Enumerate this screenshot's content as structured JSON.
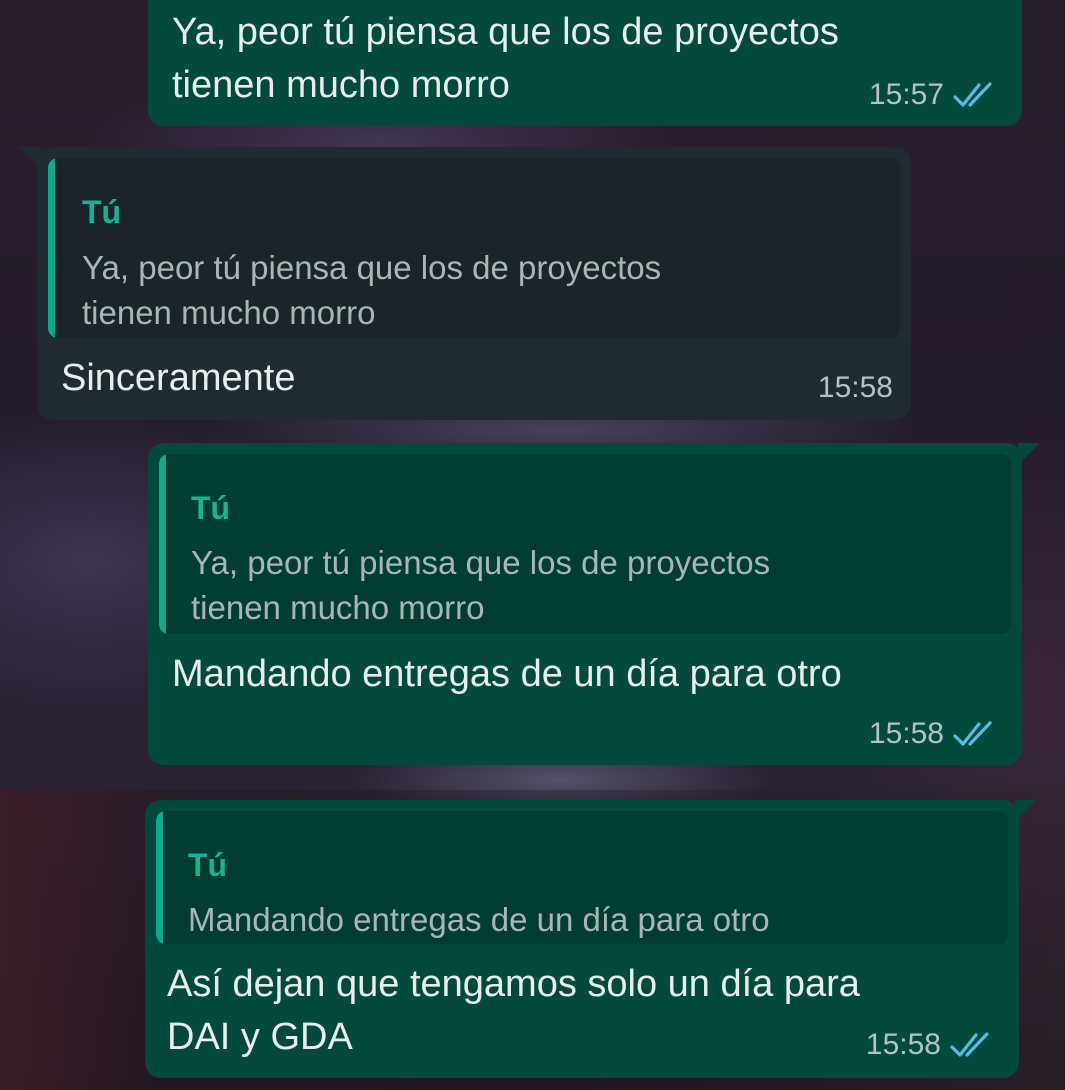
{
  "colors": {
    "outgoing_bubble": "#034a3c",
    "incoming_bubble": "#1f2b31",
    "quote_bar": "#14a88a",
    "read_ticks": "#53bdeb"
  },
  "messages": [
    {
      "direction": "outgoing",
      "text": "Ya, peor tú piensa que los de proyectos tienen mucho morro",
      "lines": [
        "Ya, peor tú piensa que los de proyectos",
        "tienen mucho morro"
      ],
      "time": "15:57",
      "status_icon": "double-check-read-icon"
    },
    {
      "direction": "incoming",
      "quote": {
        "author": "Tú",
        "lines": [
          "Ya, peor tú piensa que los de proyectos",
          "tienen mucho morro"
        ]
      },
      "text": "Sinceramente",
      "lines": [
        "Sinceramente"
      ],
      "time": "15:58"
    },
    {
      "direction": "outgoing",
      "quote": {
        "author": "Tú",
        "lines": [
          "Ya, peor tú piensa que los de proyectos",
          "tienen mucho morro"
        ]
      },
      "text": "Mandando entregas de un día para otro",
      "lines": [
        "Mandando entregas de un día para otro"
      ],
      "time": "15:58",
      "status_icon": "double-check-read-icon"
    },
    {
      "direction": "outgoing",
      "quote": {
        "author": "Tú",
        "lines": [
          "Mandando entregas de un día para otro"
        ]
      },
      "text": "Así dejan que tengamos solo un día para DAI y GDA",
      "lines": [
        "Así dejan que tengamos solo un día para",
        "DAI y GDA"
      ],
      "time": "15:58",
      "status_icon": "double-check-read-icon"
    }
  ]
}
